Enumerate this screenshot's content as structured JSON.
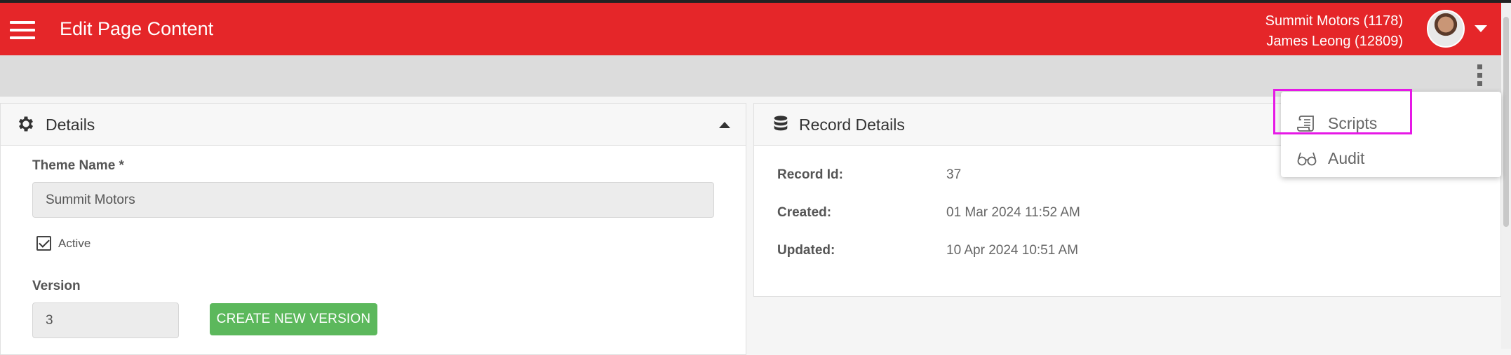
{
  "header": {
    "title": "Edit Page Content",
    "company": "Summit Motors (1178)",
    "user": "James Leong (12809)",
    "brand_color": "#e52629"
  },
  "details": {
    "title": "Details",
    "theme_name_label": "Theme Name *",
    "theme_name_value": "Summit Motors",
    "active_label": "Active",
    "active_checked": true,
    "version_label": "Version",
    "version_value": "3",
    "create_button_label": "CREATE NEW VERSION",
    "button_color": "#5cb85c"
  },
  "record_details": {
    "title": "Record Details",
    "rows": [
      {
        "label": "Record Id:",
        "value": "37"
      },
      {
        "label": "Created:",
        "value": "01 Mar 2024 11:52 AM"
      },
      {
        "label": "Updated:",
        "value": "10 Apr 2024 10:51 AM"
      }
    ]
  },
  "menu": {
    "items": [
      {
        "label": "Scripts",
        "icon": "scroll-icon"
      },
      {
        "label": "Audit",
        "icon": "glasses-icon"
      }
    ],
    "highlight_color": "#e619e6"
  }
}
